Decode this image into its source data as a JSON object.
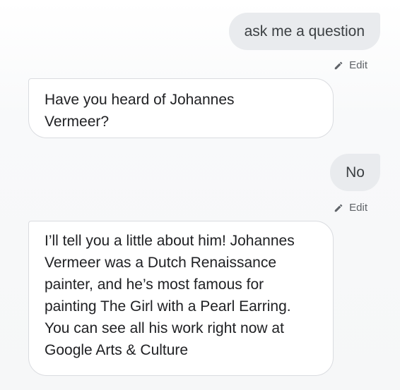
{
  "conversation": {
    "messages": [
      {
        "role": "user",
        "text": "ask me a question",
        "edit_label": "Edit"
      },
      {
        "role": "assistant",
        "text": "Have you heard of Johannes\nVermeer?"
      },
      {
        "role": "user",
        "text": "No",
        "edit_label": "Edit"
      },
      {
        "role": "assistant",
        "text": "I’ll tell you a little about him! Johannes\nVermeer was a Dutch Renaissance\npainter, and he’s most famous for\npainting The Girl with a Pearl Earring.\nYou can see all his work right now at\nGoogle Arts & Culture"
      }
    ]
  },
  "icons": {
    "edit": "pencil-icon"
  },
  "colors": {
    "user_bubble": "#e9ebee",
    "assistant_bubble": "#ffffff",
    "assistant_border": "#dadce0",
    "edit_text": "#5f6368"
  }
}
